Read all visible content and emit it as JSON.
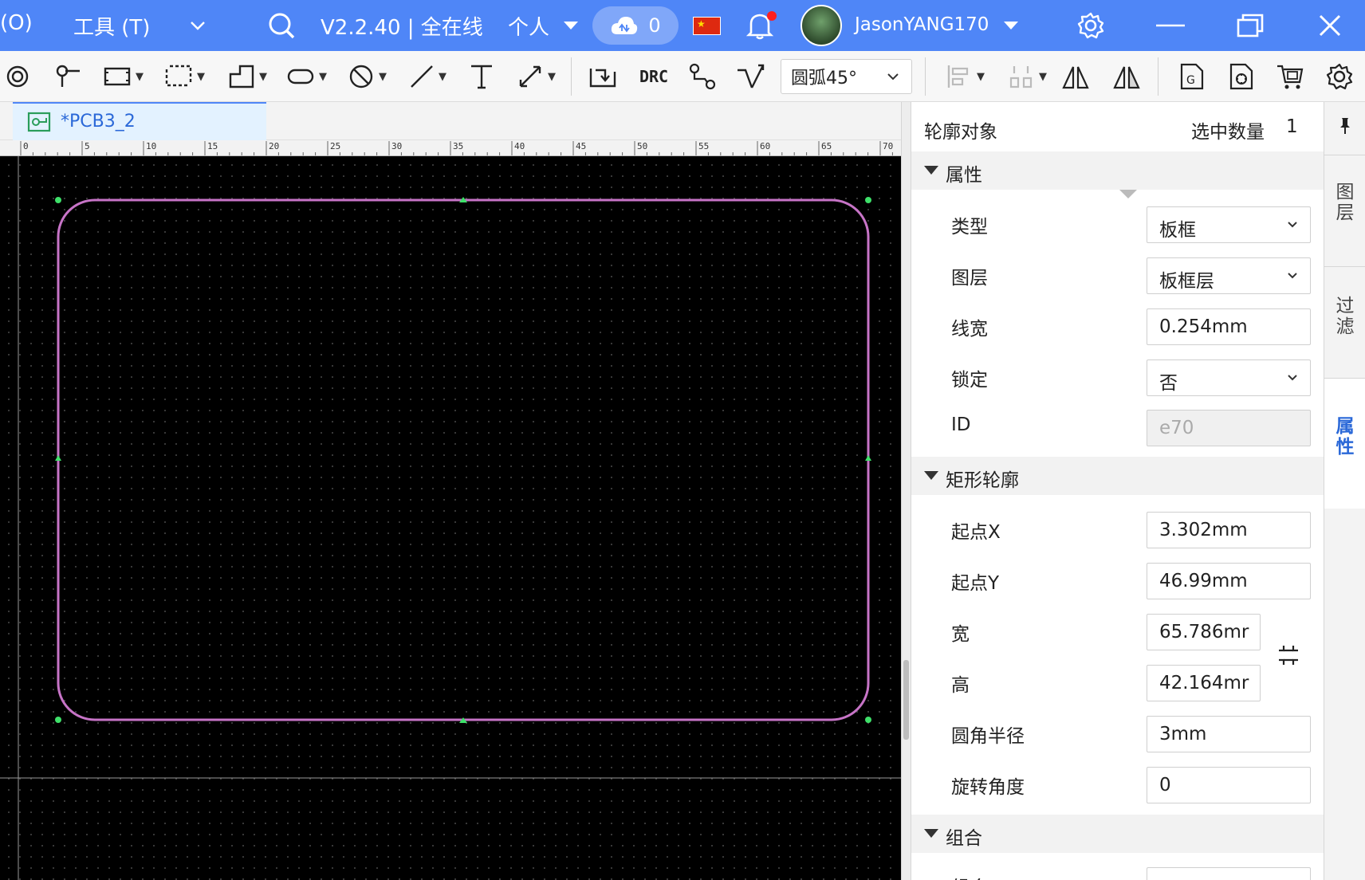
{
  "topbar": {
    "menu_partial": "(O)",
    "menu_tools": "工具 (T)",
    "version": "V2.2.40 | 全在线",
    "workspace": "个人",
    "cloud_count": "0",
    "username": "JasonYANG170"
  },
  "toolbar": {
    "drc_label": "DRC",
    "arc_mode": "圆弧45°"
  },
  "document": {
    "tab_name": "*PCB3_2"
  },
  "ruler": {
    "labels": [
      "0",
      "5",
      "10",
      "15",
      "20",
      "25",
      "30",
      "35",
      "40",
      "45",
      "50",
      "55",
      "60",
      "65",
      "70"
    ]
  },
  "panel": {
    "title": "轮廓对象",
    "selected_label": "选中数量",
    "selected_count": "1",
    "sections": {
      "attributes": "属性",
      "rect_outline": "矩形轮廓",
      "group": "组合"
    },
    "attributes": {
      "type_label": "类型",
      "type_value": "板框",
      "layer_label": "图层",
      "layer_value": "板框层",
      "linewidth_label": "线宽",
      "linewidth_value": "0.254mm",
      "lock_label": "锁定",
      "lock_value": "否",
      "id_label": "ID",
      "id_value": "e70"
    },
    "rect": {
      "startx_label": "起点X",
      "startx_value": "3.302mm",
      "starty_label": "起点Y",
      "starty_value": "46.99mm",
      "width_label": "宽",
      "width_value": "65.786mr",
      "height_label": "高",
      "height_value": "42.164mr",
      "radius_label": "圆角半径",
      "radius_value": "3mm",
      "rotation_label": "旋转角度",
      "rotation_value": "0"
    },
    "group": {
      "group_label": "组合"
    }
  },
  "vtabs": {
    "layers": [
      "图",
      "层"
    ],
    "filter": [
      "过",
      "滤"
    ],
    "props": [
      "属",
      "性"
    ]
  },
  "colors": {
    "topbar": "#4f86f7",
    "outline": "#c774c7",
    "handle": "#3fe06a",
    "active_tab_text": "#2a68d8"
  }
}
